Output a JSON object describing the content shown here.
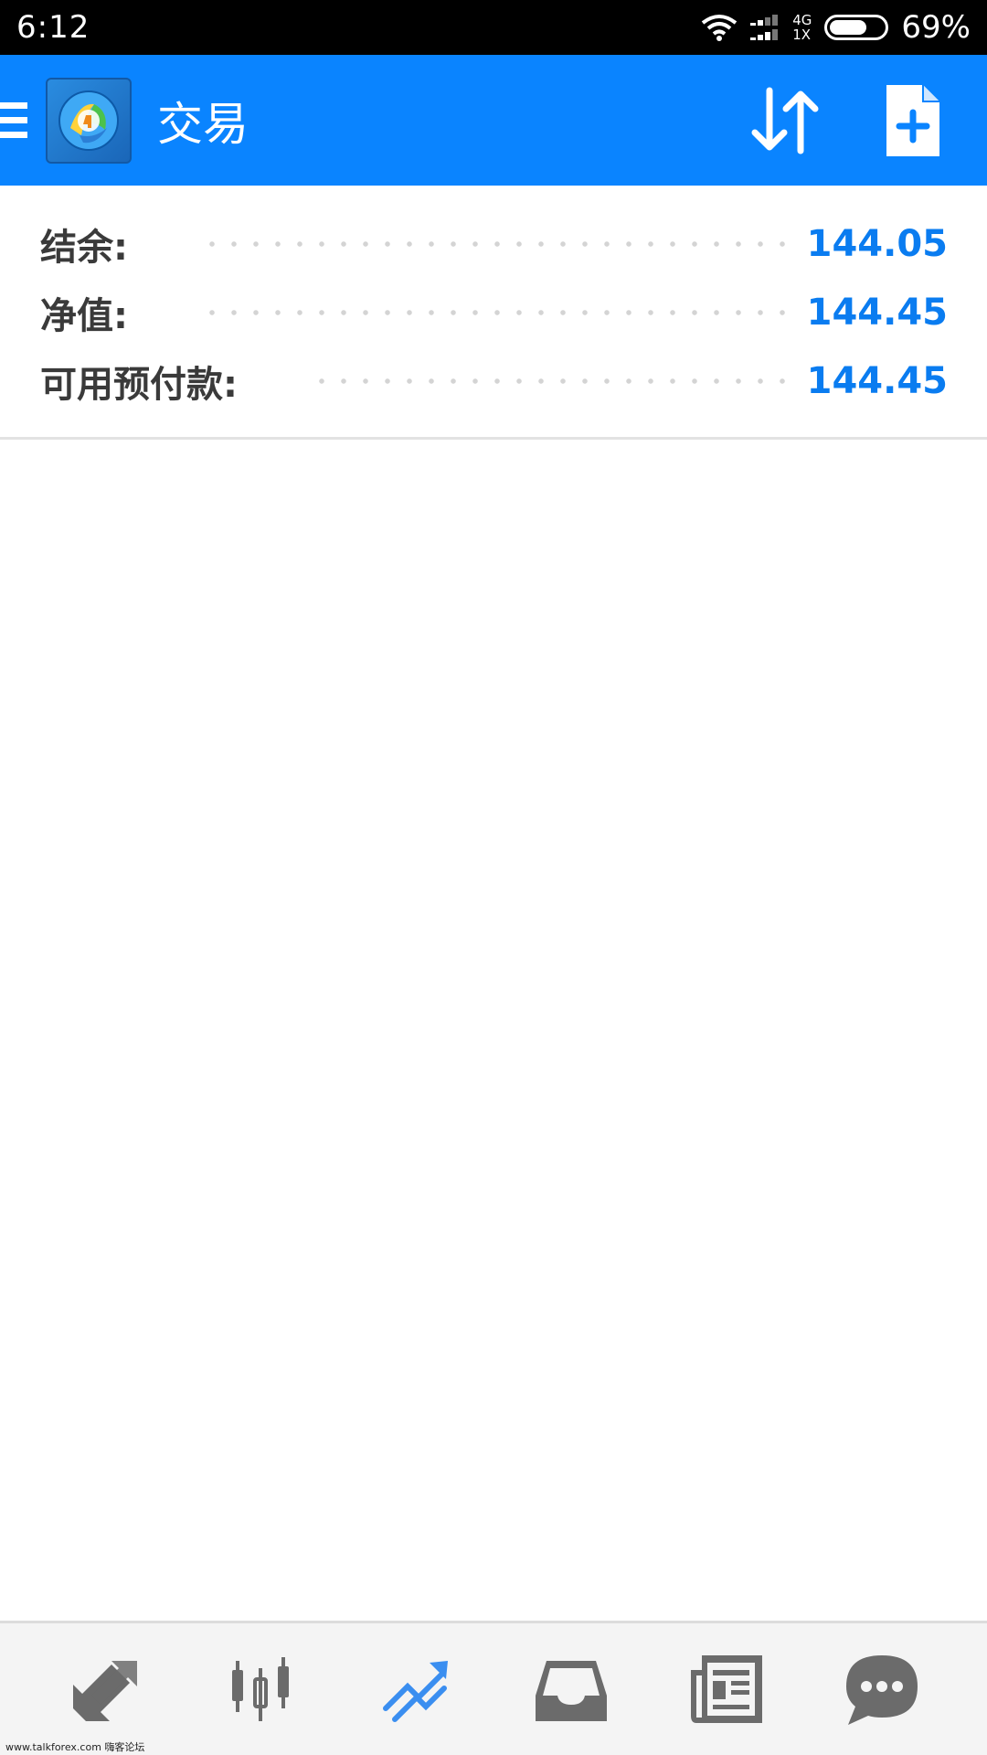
{
  "status_bar": {
    "time": "6:12",
    "network_top": "4G",
    "network_bottom": "1X",
    "battery_percent": "69%",
    "battery_level": 0.69
  },
  "app_bar": {
    "title": "交易",
    "menu_icon": "hamburger-menu-icon",
    "logo_icon": "metatrader-4-logo",
    "actions": [
      "sort-icon",
      "new-document-icon"
    ],
    "background_color": "#0a84ff"
  },
  "account_summary": [
    {
      "label": "结余:",
      "value": "144.05"
    },
    {
      "label": "净值:",
      "value": "144.45"
    },
    {
      "label": "可用预付款:",
      "value": "144.45"
    }
  ],
  "value_color": "#0a7cf0",
  "bottom_nav": {
    "items": [
      {
        "icon": "quotes-arrows-icon",
        "active": false
      },
      {
        "icon": "chart-candlestick-icon",
        "active": false
      },
      {
        "icon": "trade-icon",
        "active": true
      },
      {
        "icon": "history-inbox-icon",
        "active": false
      },
      {
        "icon": "news-icon",
        "active": false
      },
      {
        "icon": "chat-icon",
        "active": false
      }
    ],
    "active_color": "#3a8ef0",
    "inactive_color": "#6b6b6b"
  },
  "watermark": "www.talkforex.com 嗨客论坛"
}
